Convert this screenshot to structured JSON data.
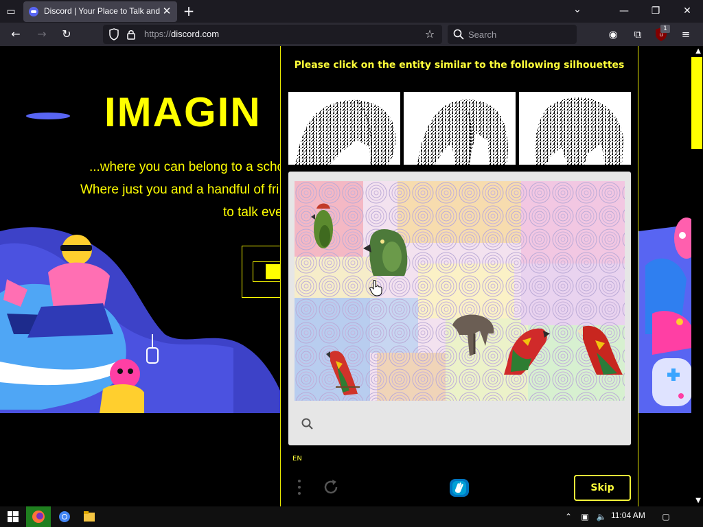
{
  "browser": {
    "tab_title": "Discord | Your Place to Talk and Hang Out",
    "url_scheme": "https://",
    "url_host": "discord.com",
    "search_placeholder": "Search",
    "ublock_badge": "1"
  },
  "hero": {
    "title": "IMAGIN",
    "line1": "...where you can belong to a scho",
    "line2": "Where just you and a handful of fri",
    "line3": "to talk eve"
  },
  "captcha": {
    "prompt": "Please click on the entity similar to the following silhouettes",
    "language": "EN",
    "skip_label": "Skip",
    "objects": [
      "parrot",
      "parrot",
      "elephant",
      "parrot",
      "parrot",
      "parrot"
    ]
  },
  "taskbar": {
    "clock": "11:04 AM"
  },
  "colors": {
    "accent": "#ffff3a",
    "discord_blurple": "#5865f2"
  }
}
